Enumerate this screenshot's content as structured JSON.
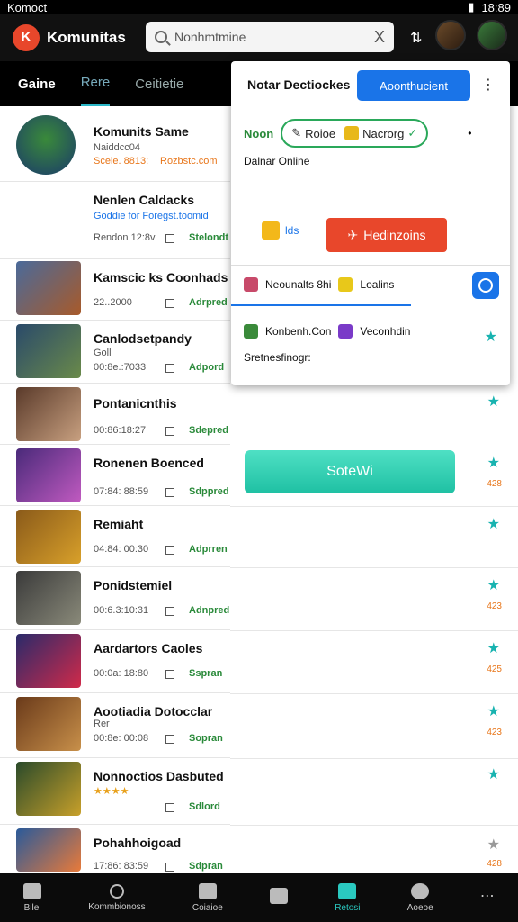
{
  "status": {
    "left": "Komoct",
    "time": "18:89"
  },
  "header": {
    "app_title": "Komunitas",
    "search_value": "Nonhmtmine",
    "clear_symbol": "X"
  },
  "tabs": [
    {
      "label": "Gaine"
    },
    {
      "label": "Rere"
    },
    {
      "label": "Ceitietie"
    }
  ],
  "list": [
    {
      "title": "Komunits Same",
      "meta": "Naiddcc04",
      "meta2": "Scele. 8813:",
      "meta3": "Rozbstc.com",
      "badge": ""
    },
    {
      "title": "Nenlen Caldacks",
      "meta": "Goddie for Foregst.toomid",
      "meta2": "Rendon 12:8v",
      "badge": "Stelondt"
    },
    {
      "title": "Kamscic ks Coonhads",
      "meta": "22..2000",
      "badge": "Adrpred"
    },
    {
      "title": "Canlodsetpandy",
      "meta": "Goll",
      "meta2": "00:8e.:7033",
      "badge": "Adpord"
    },
    {
      "title": "Pontanicnthis",
      "meta": "00:86:18:27",
      "badge": "Sdepred"
    },
    {
      "title": "Ronenen Boenced",
      "meta": "07:84: 88:59",
      "badge": "Sdppred"
    },
    {
      "title": "Remiaht",
      "meta": "04:84: 00:30",
      "badge": "Adprren"
    },
    {
      "title": "Ponidstemiel",
      "meta": "00:6.3:10:31",
      "badge": "Adnpred"
    },
    {
      "title": "Aardartors Caoles",
      "meta": "00:0a: 18:80",
      "badge": "Sspran"
    },
    {
      "title": "Aootiadia Dotocclar",
      "meta": "Rer",
      "meta2": "00:8e: 00:08",
      "badge": "Sopran"
    },
    {
      "title": "Nonnoctios Dasbuted",
      "meta": "★★★★",
      "badge": "Sdlord"
    },
    {
      "title": "Pohahhoigoad",
      "meta": "17:86: 83:59",
      "badge": "Sdpran"
    }
  ],
  "popup": {
    "title": "Notar Dectiockes",
    "button": "Aoonthucient",
    "chips": [
      "Noon",
      "Roioe",
      "Nacrorg"
    ],
    "label": "Dalnar Online",
    "lock_text": "lds",
    "red_button": "Hedinzoins",
    "row2_a": "Neounalts 8hi",
    "row2_b": "Loalins",
    "row3_a": "Konbenh.Con",
    "row3_b": "Veconhdin",
    "label2": "Sretnesfinogr:"
  },
  "right_pane": {
    "numbers": [
      "428",
      "423",
      "425",
      "423",
      "428"
    ],
    "teal_button": "SoteWi"
  },
  "nav": [
    {
      "label": "Bilei"
    },
    {
      "label": "Kommbionoss"
    },
    {
      "label": "Coiaioe"
    },
    {
      "label": ""
    },
    {
      "label": "Retosi"
    },
    {
      "label": "Aoeoe"
    },
    {
      "label": ""
    }
  ],
  "colors": {
    "accent": "#1a74e8",
    "teal": "#1fc0a3",
    "brand": "#e8472b",
    "green": "#2a8a3a"
  }
}
